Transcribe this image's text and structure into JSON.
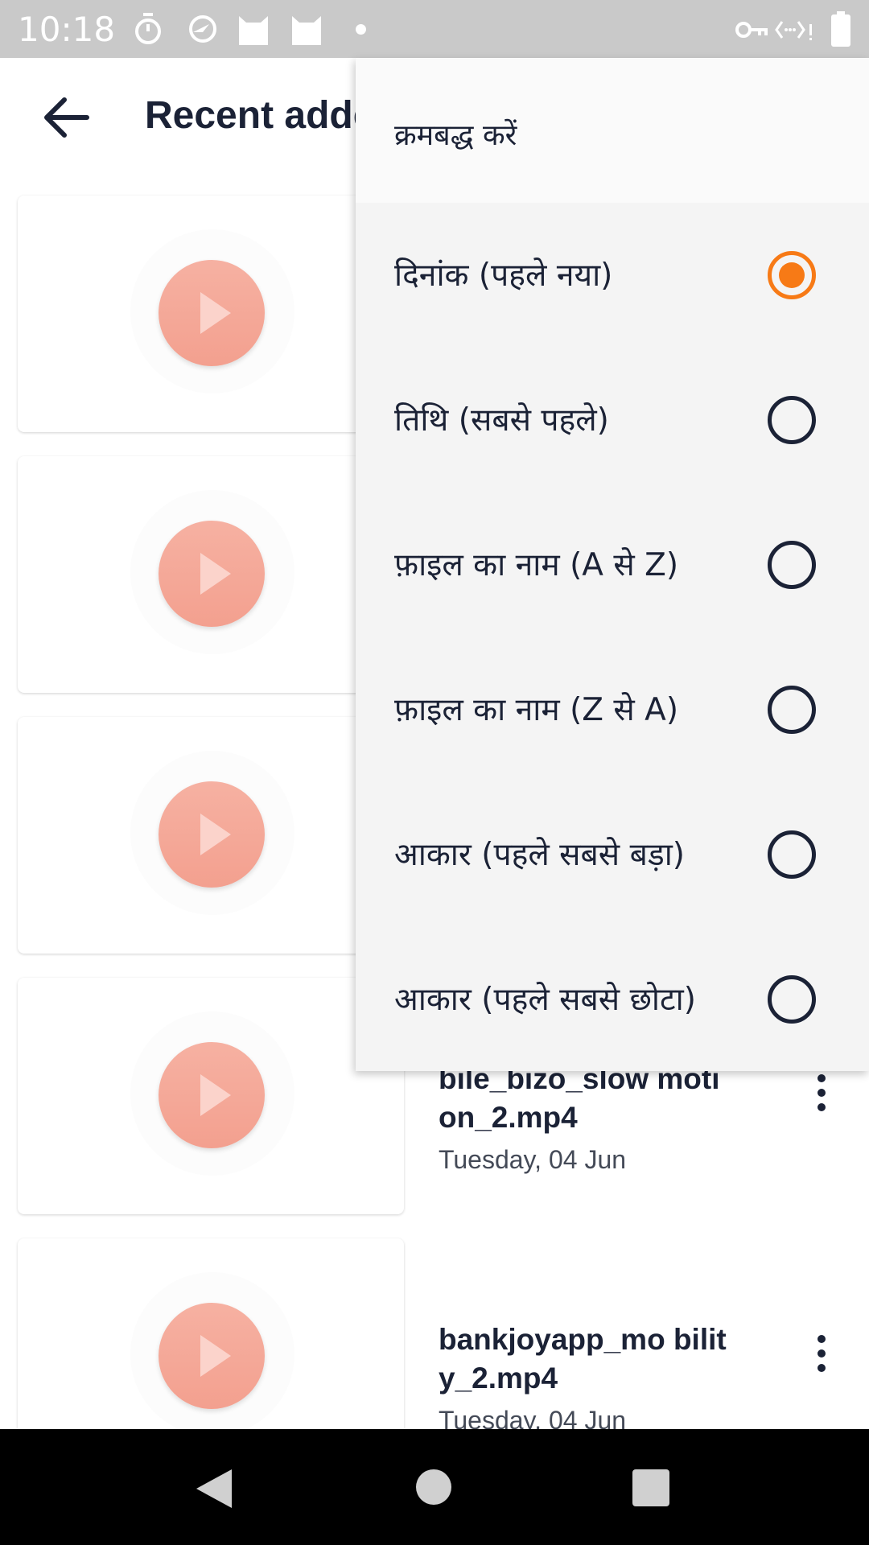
{
  "status_bar": {
    "time": "10:18",
    "icons": [
      "timer-icon",
      "vpn-swirl-icon",
      "cat-icon",
      "cat-icon",
      "dot-icon",
      "key-icon",
      "data-transfer-icon",
      "battery-icon"
    ]
  },
  "app_bar": {
    "back_icon": "arrow-back-icon",
    "title": "Recent adde"
  },
  "list": {
    "items": [
      {
        "name": "",
        "date": ""
      },
      {
        "name": "",
        "date": ""
      },
      {
        "name": "",
        "date": ""
      },
      {
        "name": "bile_bizo_slow motion_2.mp4",
        "date": "Tuesday, 04 Jun"
      },
      {
        "name": "bankjoyapp_mo bility_2.mp4",
        "date": "Tuesday, 04 Jun"
      }
    ]
  },
  "sort_menu": {
    "title": "क्रमबद्ध करें",
    "options": [
      {
        "label": "दिनांक (पहले नया)",
        "selected": true
      },
      {
        "label": "तिथि (सबसे पहले)",
        "selected": false
      },
      {
        "label": "फ़ाइल का नाम (A से Z)",
        "selected": false
      },
      {
        "label": "फ़ाइल का नाम (Z से A)",
        "selected": false
      },
      {
        "label": "आकार (पहले सबसे बड़ा)",
        "selected": false
      },
      {
        "label": "आकार (पहले सबसे छोटा)",
        "selected": false
      }
    ]
  },
  "colors": {
    "accent": "#f77a16",
    "text_primary": "#1b2236",
    "play_button": "#f4a897"
  },
  "nav_bar": {
    "icons": [
      "nav-back-icon",
      "nav-home-icon",
      "nav-recents-icon"
    ]
  }
}
